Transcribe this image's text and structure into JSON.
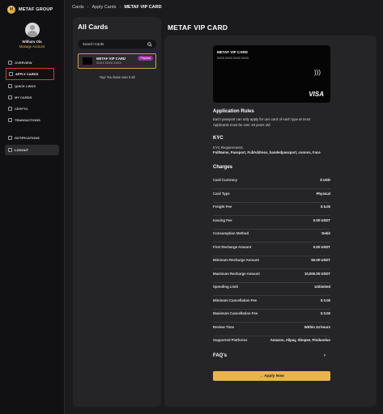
{
  "brand": {
    "name": "METAF GROUP",
    "logo_letter": "M"
  },
  "profile": {
    "name": "William Ola",
    "manage_label": "Manage Account"
  },
  "nav": {
    "items": [
      {
        "label": "OVERVIEW",
        "icon": "grid-icon"
      },
      {
        "label": "APPLY CARDS",
        "icon": "card-icon",
        "active": true
      },
      {
        "label": "QUICK LINKS",
        "icon": "link-icon"
      },
      {
        "label": "MY CARDS",
        "icon": "wallet-icon"
      },
      {
        "label": "CRYPTO",
        "icon": "crypto-icon"
      },
      {
        "label": "TRANSACTIONS",
        "icon": "list-icon"
      }
    ],
    "notifications": "NOTIFICATIONS",
    "logout": "LOGOUT"
  },
  "breadcrumb": {
    "items": [
      "Cards",
      "Apply Cards"
    ],
    "current": "METAF VIP CARD"
  },
  "left_panel": {
    "title": "All Cards",
    "search_placeholder": "Search Cards",
    "card": {
      "name": "METAF VIP CARD",
      "number": "XXXX XXXX XXXX",
      "badge": "Physical"
    },
    "owned_message": "Yay! You have own it all"
  },
  "main": {
    "title": "METAF VIP CARD",
    "card_preview": {
      "name": "METAF VIP CARD",
      "number": "XXXX XXXX XXXX XXXX",
      "network": "VISA"
    },
    "rules_title": "Application Rules",
    "rules_text": "Each passport can only apply for one card of each type at most Applicants must be over 18 years old",
    "kyc_title": "KYC",
    "kyc_req_label": "KYC Requirements",
    "kyc_req_value": "FullName, Passport, FullAddress, handedpassport, comms, Face",
    "charges_title": "Charges",
    "charges": [
      {
        "label": "Card Currency",
        "value": "$ USD"
      },
      {
        "label": "Card Type",
        "value": "Physical"
      },
      {
        "label": "Freight Fee",
        "value": "$ 5.00"
      },
      {
        "label": "Issuing Fee",
        "value": "0.00 USDT"
      },
      {
        "label": "Consumption Method",
        "value": "Debit"
      },
      {
        "label": "First Recharge Amount",
        "value": "0.00 USDT"
      },
      {
        "label": "Minimum Recharge Amount",
        "value": "50.00 USDT"
      },
      {
        "label": "Maximum Recharge Amount",
        "value": "10,000.00 USDT"
      },
      {
        "label": "Spending Limit",
        "value": "Unlimited"
      },
      {
        "label": "Minimum Cancellation Fee",
        "value": "$ 0.00"
      },
      {
        "label": "Maximum Cancellation Fee",
        "value": "$ 0.00"
      },
      {
        "label": "Review Time",
        "value": "Within 24 hours"
      },
      {
        "label": "Supported Platforms",
        "value": "Amazon, Alipay, Shopee, Pinduoduo"
      }
    ],
    "faq_label": "FAQ's",
    "faq_chevron": "›",
    "apply_label": "→ Apply Now"
  }
}
